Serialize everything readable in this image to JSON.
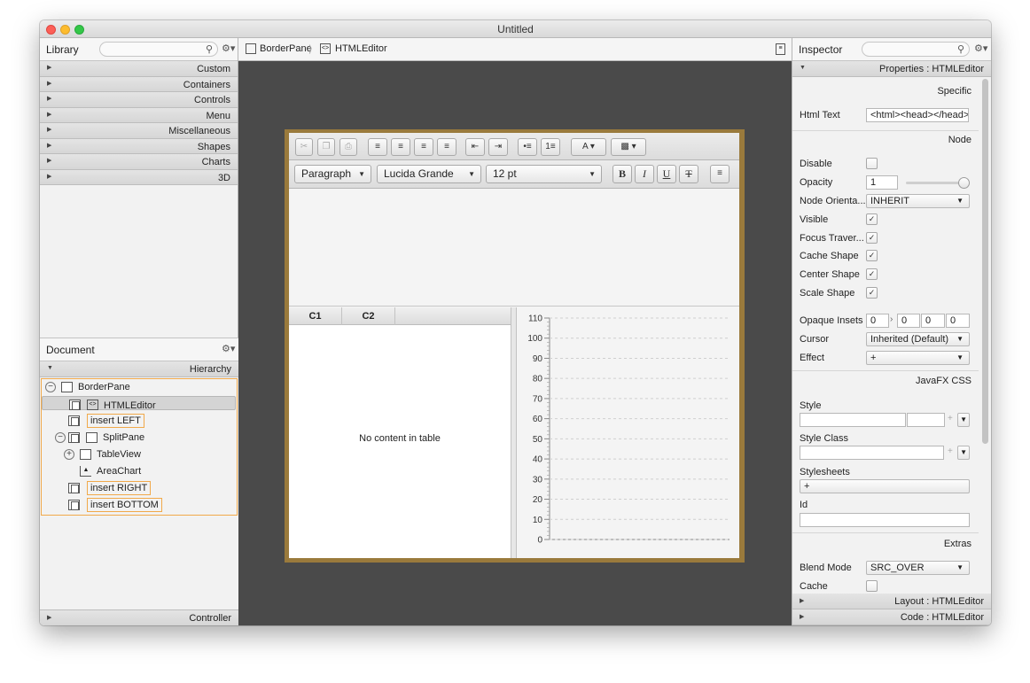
{
  "window": {
    "title": "Untitled"
  },
  "library": {
    "title": "Library",
    "categories": [
      "Custom",
      "Containers",
      "Controls",
      "Menu",
      "Miscellaneous",
      "Shapes",
      "Charts",
      "3D"
    ]
  },
  "document": {
    "title": "Document",
    "section": "Hierarchy",
    "tree": [
      {
        "label": "BorderPane",
        "icon": "borderpane-icon"
      },
      {
        "label": "HTMLEditor",
        "icon": "htmleditor-icon",
        "selected": true
      },
      {
        "label": "insert LEFT",
        "icon": "insert-left-icon"
      },
      {
        "label": "SplitPane",
        "icon": "splitpane-icon"
      },
      {
        "label": "TableView",
        "icon": "tableview-icon"
      },
      {
        "label": "AreaChart",
        "icon": "areachart-icon"
      },
      {
        "label": "insert RIGHT",
        "icon": "insert-right-icon"
      },
      {
        "label": "insert BOTTOM",
        "icon": "insert-bottom-icon"
      }
    ],
    "controller": "Controller"
  },
  "breadcrumb": [
    "BorderPane",
    "HTMLEditor"
  ],
  "editor": {
    "paragraph": "Paragraph",
    "font": "Lucida Grande",
    "size": "12 pt",
    "bold": "B",
    "italic": "I",
    "underline": "U",
    "strike": "T"
  },
  "table": {
    "columns": [
      "C1",
      "C2"
    ],
    "placeholder": "No content in table"
  },
  "chart_data": {
    "type": "area",
    "yticks": [
      "110",
      "100",
      "90",
      "80",
      "70",
      "60",
      "50",
      "40",
      "30",
      "20",
      "10",
      "0"
    ],
    "ylim": [
      0,
      110
    ],
    "series": []
  },
  "inspector": {
    "title": "Inspector",
    "properties_header": "Properties : HTMLEditor",
    "specific": "Specific",
    "html_text_label": "Html Text",
    "html_text_value": "<html><head></head><l",
    "node": "Node",
    "disable_label": "Disable",
    "opacity_label": "Opacity",
    "opacity_value": "1",
    "opacity_fraction": 1,
    "node_orientation_label": "Node Orienta...",
    "node_orientation_value": "INHERIT",
    "visible_label": "Visible",
    "focus_label": "Focus Traver...",
    "cache_shape_label": "Cache Shape",
    "center_shape_label": "Center Shape",
    "scale_shape_label": "Scale Shape",
    "opaque_label": "Opaque Insets",
    "opaque_values": [
      "0",
      "0",
      "0",
      "0"
    ],
    "cursor_label": "Cursor",
    "cursor_value": "Inherited (Default)",
    "effect_label": "Effect",
    "effect_value": "+",
    "javafx_css": "JavaFX CSS",
    "style_label": "Style",
    "style_class_label": "Style Class",
    "stylesheets_label": "Stylesheets",
    "stylesheets_add": "+",
    "id_label": "Id",
    "extras": "Extras",
    "blend_label": "Blend Mode",
    "blend_value": "SRC_OVER",
    "cache_label": "Cache",
    "layout_header": "Layout : HTMLEditor",
    "code_header": "Code : HTMLEditor",
    "check": "✓"
  }
}
